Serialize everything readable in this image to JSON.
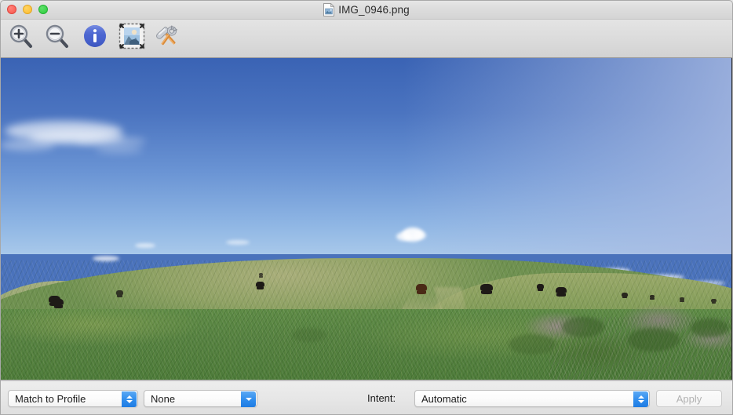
{
  "window": {
    "title": "IMG_0946.png",
    "doc_icon": "image-document-icon"
  },
  "traffic_lights": {
    "close": "close-button",
    "minimize": "minimize-button",
    "zoom": "zoom-button",
    "close_color": "#f9564c",
    "minimize_color": "#fdbc2e",
    "zoom_color": "#2bcb3d"
  },
  "toolbar": {
    "items": [
      {
        "name": "zoom-in",
        "icon": "magnifier-plus-icon",
        "label": "Zoom In"
      },
      {
        "name": "zoom-out",
        "icon": "magnifier-minus-icon",
        "label": "Zoom Out"
      },
      {
        "name": "info",
        "icon": "info-circle-icon",
        "label": "Info"
      },
      {
        "name": "resize",
        "icon": "image-resize-icon",
        "label": "Resize"
      },
      {
        "name": "tools",
        "icon": "hammer-wrench-icon",
        "label": "Tools"
      }
    ]
  },
  "image": {
    "alt": "Panoramic photograph of black cattle grazing on a green grassy hillside under a deep blue sky with scattered white clouds",
    "sky_top_color": "#3a63b4",
    "sky_horizon_color": "#a8c8ea",
    "grass_color": "#5d8a45"
  },
  "bottom_bar": {
    "match_popup": {
      "value": "Match to Profile",
      "arrow": "up-down-chevron"
    },
    "profile_popup": {
      "value": "None",
      "arrow": "down-chevron"
    },
    "intent_label": "Intent:",
    "intent_popup": {
      "value": "Automatic",
      "arrow": "up-down-chevron"
    },
    "apply_button": {
      "label": "Apply",
      "enabled": false
    },
    "accent_color": "#2f8ced"
  }
}
